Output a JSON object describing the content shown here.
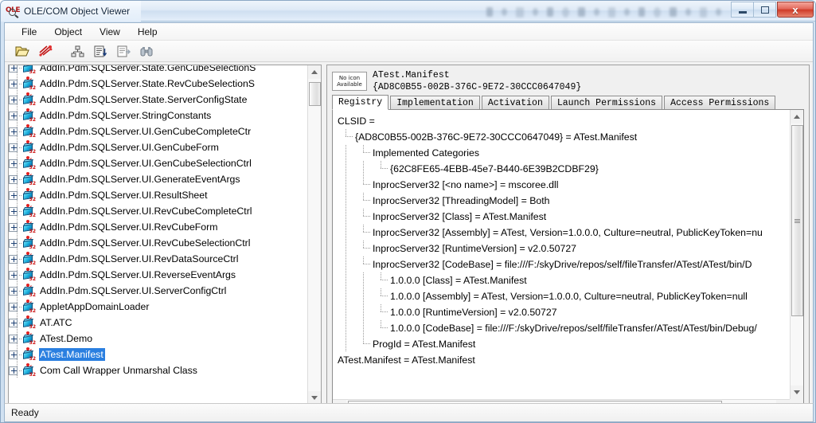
{
  "window": {
    "title": "OLE/COM Object Viewer",
    "app_icon": "ole-viewer-icon",
    "buttons": {
      "minimize": "minimize-button",
      "maximize": "maximize-button",
      "close_label": "x"
    }
  },
  "menubar": {
    "items": [
      {
        "label": "File",
        "name": "menu-file"
      },
      {
        "label": "Object",
        "name": "menu-object"
      },
      {
        "label": "View",
        "name": "menu-view"
      },
      {
        "label": "Help",
        "name": "menu-help"
      }
    ]
  },
  "toolbar": {
    "buttons": [
      {
        "name": "open-folder-icon",
        "title": "Open"
      },
      {
        "name": "sparkle-icon",
        "title": "Expert Mode"
      },
      {
        "name": "hierarchy-icon",
        "title": "View TypeLib"
      },
      {
        "name": "list-sort-icon",
        "title": "Registry"
      },
      {
        "name": "document-properties-icon",
        "title": "Properties"
      },
      {
        "name": "binoculars-icon",
        "title": "Find"
      }
    ]
  },
  "tree": {
    "items": [
      {
        "label": "AddIn.Pdm.SQLServer.State.GenCubeSelectionS",
        "selected": false
      },
      {
        "label": "AddIn.Pdm.SQLServer.State.RevCubeSelectionS",
        "selected": false
      },
      {
        "label": "AddIn.Pdm.SQLServer.State.ServerConfigState",
        "selected": false
      },
      {
        "label": "AddIn.Pdm.SQLServer.StringConstants",
        "selected": false
      },
      {
        "label": "AddIn.Pdm.SQLServer.UI.GenCubeCompleteCtr",
        "selected": false
      },
      {
        "label": "AddIn.Pdm.SQLServer.UI.GenCubeForm",
        "selected": false
      },
      {
        "label": "AddIn.Pdm.SQLServer.UI.GenCubeSelectionCtrl",
        "selected": false
      },
      {
        "label": "AddIn.Pdm.SQLServer.UI.GenerateEventArgs",
        "selected": false
      },
      {
        "label": "AddIn.Pdm.SQLServer.UI.ResultSheet",
        "selected": false
      },
      {
        "label": "AddIn.Pdm.SQLServer.UI.RevCubeCompleteCtrl",
        "selected": false
      },
      {
        "label": "AddIn.Pdm.SQLServer.UI.RevCubeForm",
        "selected": false
      },
      {
        "label": "AddIn.Pdm.SQLServer.UI.RevCubeSelectionCtrl",
        "selected": false
      },
      {
        "label": "AddIn.Pdm.SQLServer.UI.RevDataSourceCtrl",
        "selected": false
      },
      {
        "label": "AddIn.Pdm.SQLServer.UI.ReverseEventArgs",
        "selected": false
      },
      {
        "label": "AddIn.Pdm.SQLServer.UI.ServerConfigCtrl",
        "selected": false
      },
      {
        "label": "AppletAppDomainLoader",
        "selected": false
      },
      {
        "label": "AT.ATC",
        "selected": false
      },
      {
        "label": "ATest.Demo",
        "selected": false
      },
      {
        "label": "ATest.Manifest",
        "selected": true
      },
      {
        "label": "Com Call Wrapper Unmarshal Class",
        "selected": false
      }
    ]
  },
  "detail": {
    "no_icon_line1": "No icon",
    "no_icon_line2": "Available",
    "object_name": "ATest.Manifest",
    "object_clsid": "{AD8C0B55-002B-376C-9E72-30CCC0647049}",
    "tabs": [
      {
        "label": "Registry",
        "active": true
      },
      {
        "label": "Implementation",
        "active": false
      },
      {
        "label": "Activation",
        "active": false
      },
      {
        "label": "Launch Permissions",
        "active": false
      },
      {
        "label": "Access Permissions",
        "active": false
      }
    ],
    "registry_rows": [
      {
        "indent": 0,
        "text": "CLSID =",
        "connector": false
      },
      {
        "indent": 1,
        "text": "{AD8C0B55-002B-376C-9E72-30CCC0647049} = ATest.Manifest",
        "connector": true
      },
      {
        "indent": 2,
        "text": "Implemented Categories",
        "connector": true
      },
      {
        "indent": 3,
        "text": "{62C8FE65-4EBB-45e7-B440-6E39B2CDBF29}",
        "connector": true
      },
      {
        "indent": 2,
        "text": "InprocServer32 [<no name>] = mscoree.dll",
        "connector": true
      },
      {
        "indent": 2,
        "text": "InprocServer32 [ThreadingModel] = Both",
        "connector": true
      },
      {
        "indent": 2,
        "text": "InprocServer32 [Class] = ATest.Manifest",
        "connector": true
      },
      {
        "indent": 2,
        "text": "InprocServer32 [Assembly] = ATest, Version=1.0.0.0, Culture=neutral, PublicKeyToken=nu",
        "connector": true
      },
      {
        "indent": 2,
        "text": "InprocServer32 [RuntimeVersion] = v2.0.50727",
        "connector": true
      },
      {
        "indent": 2,
        "text": "InprocServer32 [CodeBase] = file:///F:/skyDrive/repos/self/fileTransfer/ATest/ATest/bin/D",
        "connector": true
      },
      {
        "indent": 3,
        "text": "1.0.0.0 [Class] = ATest.Manifest",
        "connector": true
      },
      {
        "indent": 3,
        "text": "1.0.0.0 [Assembly] = ATest, Version=1.0.0.0, Culture=neutral, PublicKeyToken=null",
        "connector": true
      },
      {
        "indent": 3,
        "text": "1.0.0.0 [RuntimeVersion] = v2.0.50727",
        "connector": true
      },
      {
        "indent": 3,
        "text": "1.0.0.0 [CodeBase] = file:///F:/skyDrive/repos/self/fileTransfer/ATest/ATest/bin/Debug/",
        "connector": true
      },
      {
        "indent": 2,
        "text": "ProgId = ATest.Manifest",
        "connector": true
      },
      {
        "indent": 0,
        "text": "ATest.Manifest = ATest.Manifest",
        "connector": false
      }
    ]
  },
  "statusbar": {
    "text": "Ready"
  },
  "colors": {
    "selection": "#2a7fe0",
    "close_button": "#cf3b28",
    "com_icon": "#15a8d8",
    "com_icon_accent": "#d01818"
  }
}
